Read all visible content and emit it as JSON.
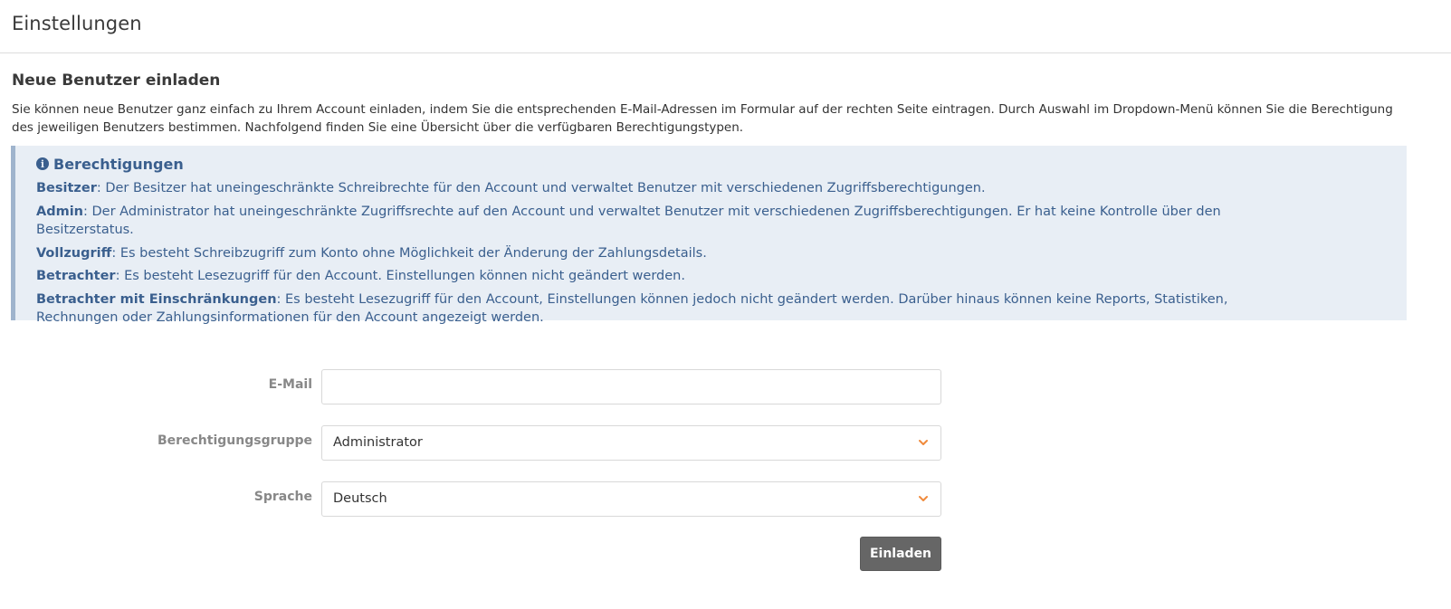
{
  "header": {
    "title": "Einstellungen"
  },
  "invite": {
    "title": "Neue Benutzer einladen",
    "description": "Sie können neue Benutzer ganz einfach zu Ihrem Account einladen, indem Sie die entsprechenden E-Mail-Adressen im Formular auf der rechten Seite eintragen. Durch Auswahl im Dropdown-Menü können Sie die Berechtigung des jeweiligen Benutzers bestimmen. Nachfolgend finden Sie eine Übersicht über die verfügbaren Berechtigungstypen."
  },
  "permissions": {
    "title": "Berechtigungen",
    "icon": "info-circle-icon",
    "items": [
      {
        "name": "Besitzer",
        "description": ": Der Besitzer hat uneingeschränkte Schreibrechte für den Account und verwaltet Benutzer mit verschiedenen Zugriffsberechtigungen."
      },
      {
        "name": "Admin",
        "description": ": Der Administrator hat uneingeschränkte Zugriffsrechte auf den Account und verwaltet Benutzer mit verschiedenen Zugriffsberechtigungen. Er hat keine Kontrolle über den Besitzerstatus."
      },
      {
        "name": "Vollzugriff",
        "description": ": Es besteht Schreibzugriff zum Konto ohne Möglichkeit der Änderung der Zahlungsdetails."
      },
      {
        "name": "Betrachter",
        "description": ": Es besteht Lesezugriff für den Account. Einstellungen können nicht geändert werden."
      },
      {
        "name": "Betrachter mit Einschränkungen",
        "description": ": Es besteht Lesezugriff für den Account, Einstellungen können jedoch nicht geändert werden. Darüber hinaus können keine Reports, Statistiken, Rechnungen oder Zahlungsinformationen für den Account angezeigt werden."
      }
    ]
  },
  "form": {
    "email_label": "E-Mail",
    "email_value": "",
    "group_label": "Berechtigungsgruppe",
    "group_value": "Administrator",
    "language_label": "Sprache",
    "language_value": "Deutsch",
    "submit_label": "Einladen"
  },
  "colors": {
    "accent_chevron": "#f08a3c",
    "info_text": "#3a5f8e",
    "info_bg": "#e8eef5",
    "button_bg": "#666666"
  }
}
